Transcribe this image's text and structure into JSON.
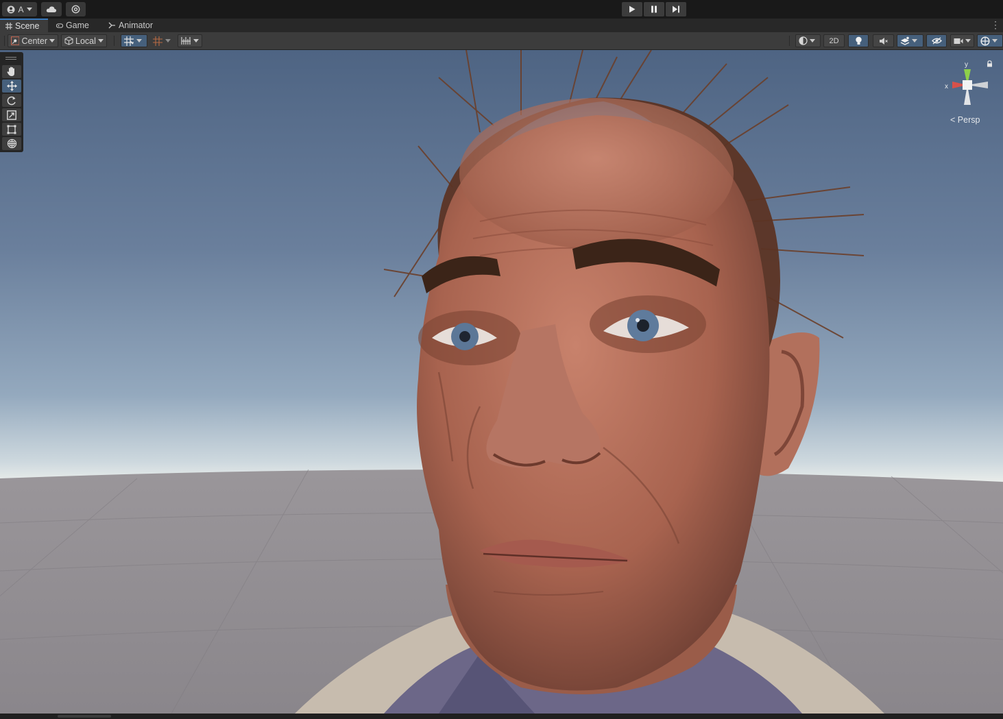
{
  "topbar": {
    "account_label": "A",
    "icons": [
      "user-icon",
      "cloud-icon",
      "settings-icon"
    ],
    "play_controls": [
      "play-icon",
      "pause-icon",
      "step-icon"
    ]
  },
  "tabs": [
    {
      "label": "Scene",
      "icon": "grid-icon",
      "active": true
    },
    {
      "label": "Game",
      "icon": "gamepad-icon",
      "active": false
    },
    {
      "label": "Animator",
      "icon": "animator-icon",
      "active": false
    }
  ],
  "toolbar": {
    "pivot_label": "Center",
    "space_label": "Local",
    "mode_2d_label": "2D"
  },
  "tools": [
    "hand-tool",
    "move-tool",
    "rotate-tool",
    "scale-tool",
    "rect-tool",
    "transform-tool"
  ],
  "gizmo": {
    "x_label": "x",
    "y_label": "y",
    "projection_label": "Persp"
  },
  "colors": {
    "accent": "#3a79bb",
    "active_tool": "#46607c",
    "panel": "#3c3c3c",
    "x_axis": "#d8514a",
    "y_axis": "#8ed04a"
  }
}
